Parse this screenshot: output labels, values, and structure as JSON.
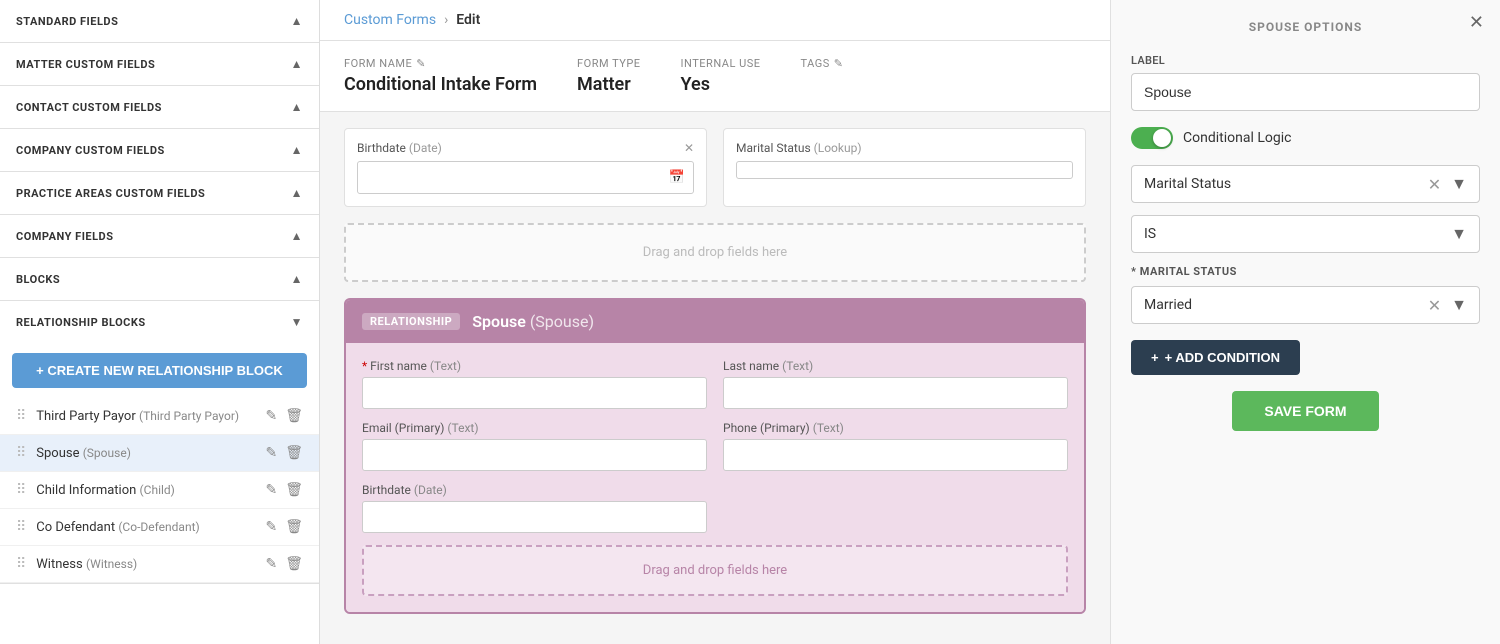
{
  "sidebar": {
    "sections": [
      {
        "id": "standard-fields",
        "label": "STANDARD FIELDS",
        "arrow": "▲"
      },
      {
        "id": "matter-custom-fields",
        "label": "MATTER CUSTOM FIELDS",
        "arrow": "▲"
      },
      {
        "id": "contact-custom-fields",
        "label": "CONTACT CUSTOM FIELDS",
        "arrow": "▲"
      },
      {
        "id": "company-custom-fields",
        "label": "COMPANY CUSTOM FIELDS",
        "arrow": "▲"
      },
      {
        "id": "practice-areas-custom-fields",
        "label": "PRACTICE AREAS CUSTOM FIELDS",
        "arrow": "▲"
      },
      {
        "id": "company-fields",
        "label": "COMPANY FIELDS",
        "arrow": "▲"
      },
      {
        "id": "blocks",
        "label": "BLOCKS",
        "arrow": "▲"
      },
      {
        "id": "relationship-blocks",
        "label": "RELATIONSHIP BLOCKS",
        "arrow": "▼"
      }
    ],
    "create_btn": "+ CREATE NEW RELATIONSHIP BLOCK",
    "relationship_items": [
      {
        "label": "Third Party Payor",
        "sub": "Third Party Payor",
        "highlighted": false
      },
      {
        "label": "Spouse",
        "sub": "Spouse",
        "highlighted": true
      },
      {
        "label": "Child Information",
        "sub": "Child",
        "highlighted": false
      },
      {
        "label": "Co Defendant",
        "sub": "Co-Defendant",
        "highlighted": false
      },
      {
        "label": "Witness",
        "sub": "Witness",
        "highlighted": false
      }
    ]
  },
  "breadcrumb": {
    "parent": "Custom Forms",
    "current": "Edit"
  },
  "form_meta": {
    "form_name_label": "FORM NAME",
    "form_name": "Conditional Intake Form",
    "form_type_label": "FORM TYPE",
    "form_type": "Matter",
    "internal_use_label": "INTERNAL USE",
    "internal_use": "Yes",
    "tags_label": "TAGS"
  },
  "canvas": {
    "field1_label": "Birthdate",
    "field1_type": "(Date)",
    "field2_label": "Marital Status",
    "field2_type": "(Lookup)",
    "drop_zone1": "Drag and drop fields here",
    "relationship_tag": "RELATIONSHIP",
    "relationship_title": "Spouse",
    "relationship_sub": "(Spouse)",
    "fields": [
      {
        "label": "First name",
        "type": "(Text)",
        "required": true
      },
      {
        "label": "Last name",
        "type": "(Text)",
        "required": false
      },
      {
        "label": "Email (Primary)",
        "type": "(Text)",
        "required": false
      },
      {
        "label": "Phone (Primary)",
        "type": "(Text)",
        "required": false
      },
      {
        "label": "Birthdate",
        "type": "(Date)",
        "required": false
      }
    ],
    "drop_zone2": "Drag and drop fields here"
  },
  "right_panel": {
    "title": "SPOUSE OPTIONS",
    "close_icon": "✕",
    "label_field_label": "LABEL",
    "label_value": "Spouse",
    "toggle_label": "Conditional Logic",
    "marital_status_value": "Marital Status",
    "condition_value": "IS",
    "marital_status_section_label": "* MARITAL STATUS",
    "marital_status_selected": "Married",
    "add_condition_label": "+ ADD CONDITION",
    "save_form_label": "SAVE FORM"
  }
}
